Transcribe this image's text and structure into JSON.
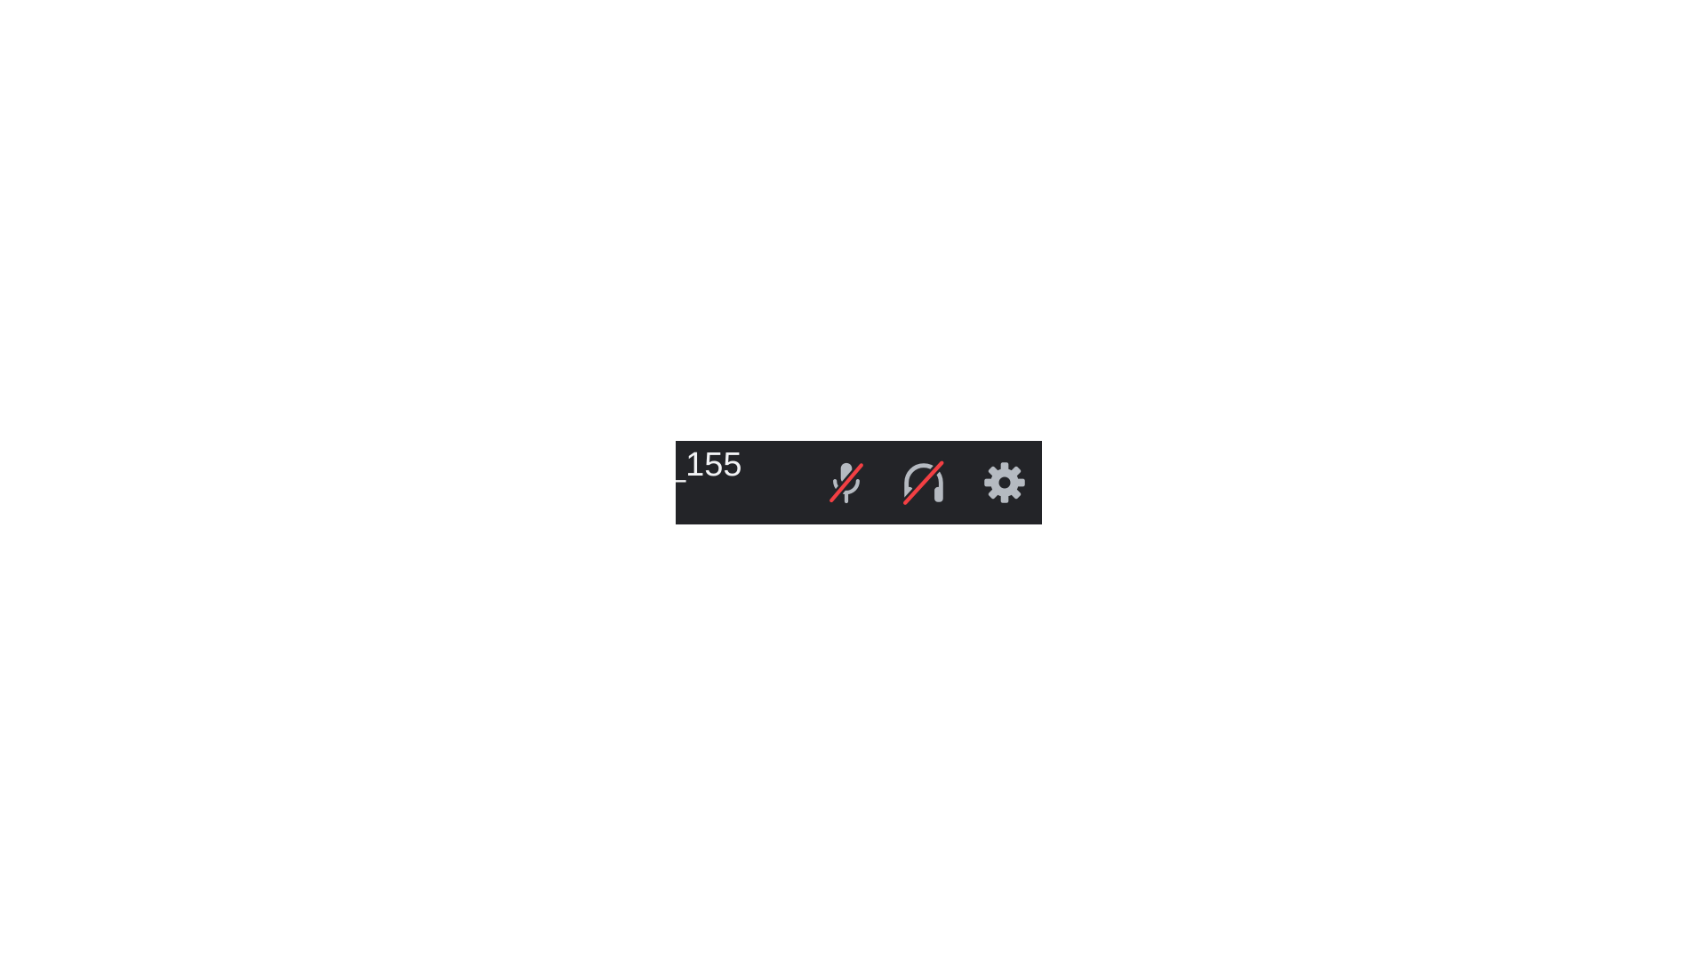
{
  "user_panel": {
    "username": "_155",
    "controls": {
      "mute": {
        "icon": "microphone-muted-icon",
        "state": "muted"
      },
      "deafen": {
        "icon": "headphones-deafened-icon",
        "state": "deafened"
      },
      "settings": {
        "icon": "gear-icon"
      }
    }
  },
  "colors": {
    "panel_background": "#232428",
    "icon": "#b5bac1",
    "strike": "#f23f43",
    "username": "#f2f3f5"
  }
}
